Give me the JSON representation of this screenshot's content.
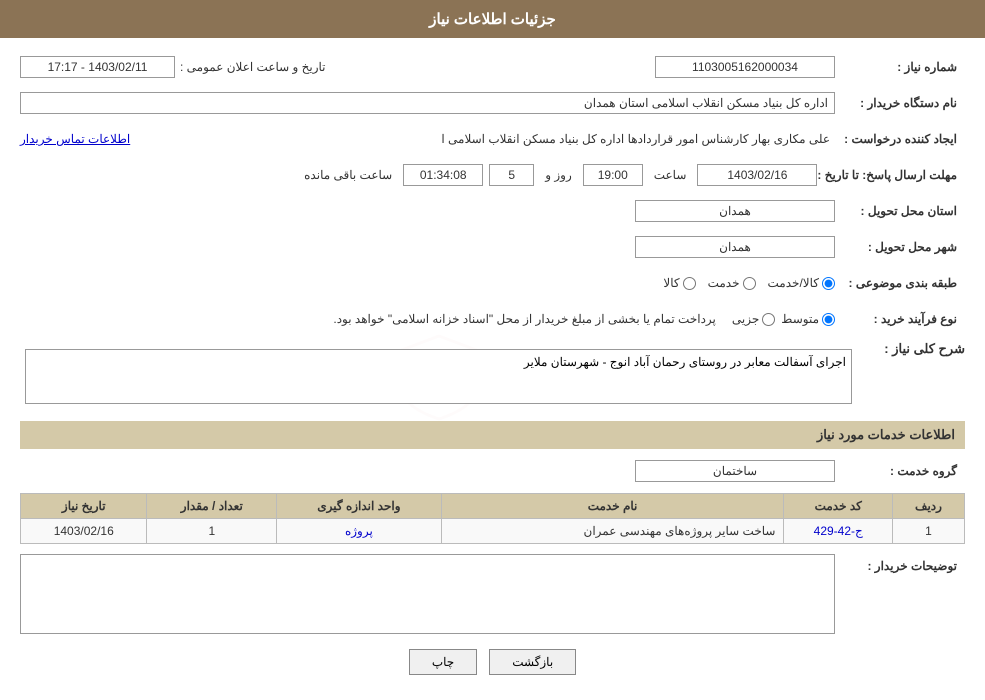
{
  "header": {
    "title": "جزئیات اطلاعات نیاز"
  },
  "fields": {
    "need_number_label": "شماره نیاز :",
    "need_number_value": "1103005162000034",
    "buyer_org_label": "نام دستگاه خریدار :",
    "buyer_org_value": "اداره کل بنیاد مسکن انقلاب اسلامی استان همدان",
    "creator_label": "ایجاد کننده درخواست :",
    "creator_value": "علی مکاری بهار کارشناس امور قراردادها اداره کل بنیاد مسکن انقلاب اسلامی ا",
    "creator_link": "اطلاعات تماس خریدار",
    "deadline_label": "مهلت ارسال پاسخ: تا تاریخ :",
    "deadline_date": "1403/02/16",
    "deadline_time_label": "ساعت",
    "deadline_time": "19:00",
    "deadline_days_label": "روز و",
    "deadline_days": "5",
    "deadline_remain_label": "ساعت باقی مانده",
    "deadline_remain": "01:34:08",
    "province_label": "استان محل تحویل :",
    "province_value": "همدان",
    "city_label": "شهر محل تحویل :",
    "city_value": "همدان",
    "category_label": "طبقه بندی موضوعی :",
    "category_options": [
      {
        "label": "کالا",
        "value": "kala",
        "checked": false
      },
      {
        "label": "خدمت",
        "value": "khedmat",
        "checked": false
      },
      {
        "label": "کالا/خدمت",
        "value": "kala_khedmat",
        "checked": true
      }
    ],
    "purchase_type_label": "نوع فرآیند خرید :",
    "purchase_type_options": [
      {
        "label": "جزیی",
        "value": "jozi",
        "checked": false
      },
      {
        "label": "متوسط",
        "value": "motavasset",
        "checked": true
      }
    ],
    "purchase_type_note": "پرداخت تمام یا بخشی از مبلغ خریدار از محل \"اسناد خزانه اسلامی\" خواهد بود.",
    "narration_label": "شرح کلی نیاز :",
    "narration_value": "اجرای آسفالت معابر در روستای رحمان آباد انوج - شهرستان ملایر",
    "services_section_label": "اطلاعات خدمات مورد نیاز",
    "service_group_label": "گروه خدمت :",
    "service_group_value": "ساختمان",
    "table": {
      "columns": [
        "ردیف",
        "کد خدمت",
        "نام خدمت",
        "واحد اندازه گیری",
        "تعداد / مقدار",
        "تاریخ نیاز"
      ],
      "rows": [
        {
          "row_num": "1",
          "code": "ج-42-429",
          "name": "ساخت سایر پروژه‌های مهندسی عمران",
          "unit": "پروژه",
          "qty": "1",
          "date": "1403/02/16"
        }
      ]
    },
    "buyer_desc_label": "توضیحات خریدار :",
    "buyer_desc_value": ""
  },
  "buttons": {
    "print_label": "چاپ",
    "back_label": "بازگشت"
  }
}
